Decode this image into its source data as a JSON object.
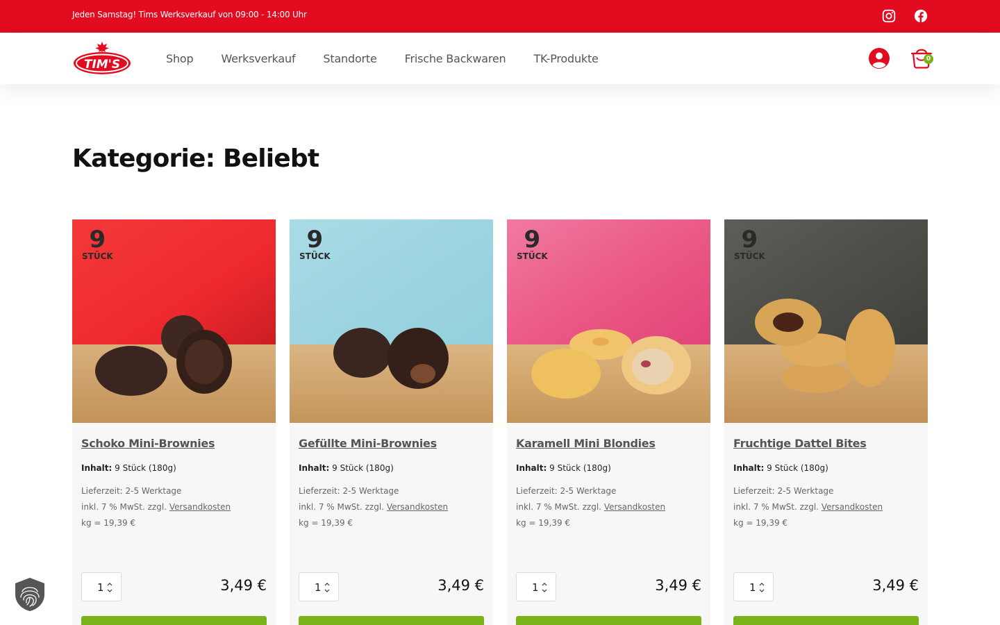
{
  "topbar": {
    "announcement": "Jeden Samstag! Tims Werksverkauf von 09:00 - 14:00 Uhr",
    "social_icons": [
      "instagram-icon",
      "facebook-icon"
    ]
  },
  "header": {
    "logo_text": "TIM'S",
    "nav": [
      "Shop",
      "Werksverkauf",
      "Standorte",
      "Frische Backwaren",
      "TK-Produkte"
    ],
    "cart_count": "0"
  },
  "page": {
    "title": "Kategorie: Beliebt"
  },
  "products": [
    {
      "badge_num": "9",
      "badge_unit": "STÜCK",
      "title": "Schoko Mini-Brownies",
      "inhalt_label": "Inhalt:",
      "inhalt_value": "9 Stück (180g)",
      "lieferzeit": "Lieferzeit: 2-5 Werktage",
      "tax_prefix": "inkl. 7 % MwSt. zzgl.",
      "tax_link": "Versandkosten",
      "unit_price": "kg = 19,39 €",
      "qty": "1",
      "price": "3,49 €"
    },
    {
      "badge_num": "9",
      "badge_unit": "STÜCK",
      "title": "Gefüllte Mini-Brownies",
      "inhalt_label": "Inhalt:",
      "inhalt_value": "9 Stück (180g)",
      "lieferzeit": "Lieferzeit: 2-5 Werktage",
      "tax_prefix": "inkl. 7 % MwSt. zzgl.",
      "tax_link": "Versandkosten",
      "unit_price": "kg = 19,39 €",
      "qty": "1",
      "price": "3,49 €"
    },
    {
      "badge_num": "9",
      "badge_unit": "STÜCK",
      "title": "Karamell Mini Blondies",
      "inhalt_label": "Inhalt:",
      "inhalt_value": "9 Stück (180g)",
      "lieferzeit": "Lieferzeit: 2-5 Werktage",
      "tax_prefix": "inkl. 7 % MwSt. zzgl.",
      "tax_link": "Versandkosten",
      "unit_price": "kg = 19,39 €",
      "qty": "1",
      "price": "3,49 €"
    },
    {
      "badge_num": "9",
      "badge_unit": "STÜCK",
      "title": "Fruchtige Dattel Bites",
      "inhalt_label": "Inhalt:",
      "inhalt_value": "9 Stück (180g)",
      "lieferzeit": "Lieferzeit: 2-5 Werktage",
      "tax_prefix": "inkl. 7 % MwSt. zzgl.",
      "tax_link": "Versandkosten",
      "unit_price": "kg = 19,39 €",
      "qty": "1",
      "price": "3,49 €"
    }
  ],
  "colors": {
    "brand_red": "#e30b20",
    "accent_green": "#7ab317",
    "card_bg": "#f7f7f7"
  }
}
